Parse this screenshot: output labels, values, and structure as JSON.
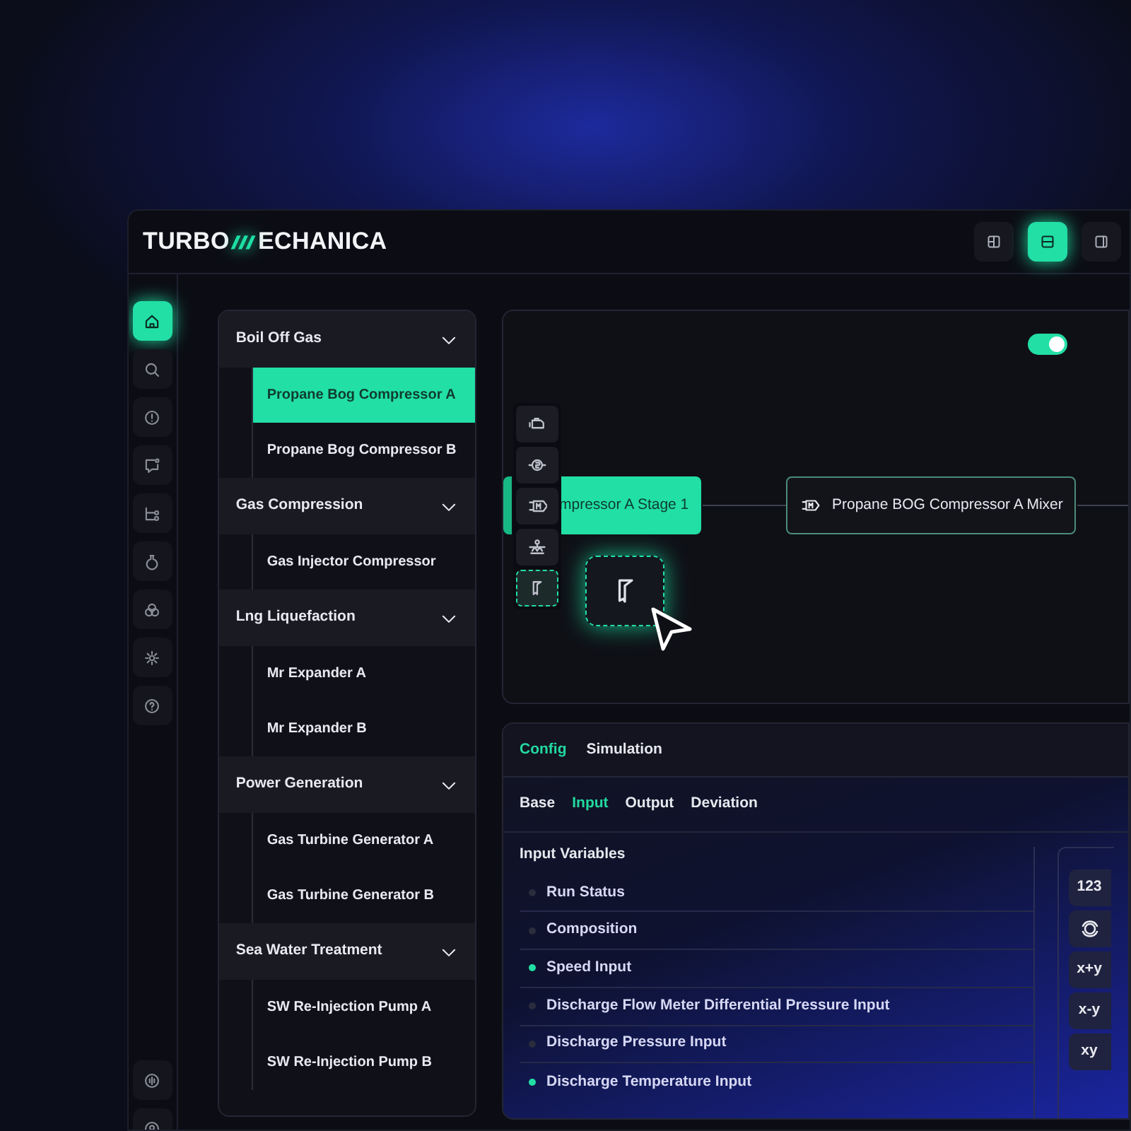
{
  "header": {
    "logo_left": "TURBO",
    "logo_right": "ECHANICA",
    "layout_buttons": [
      {
        "selected": false
      },
      {
        "selected": true
      },
      {
        "selected": false
      }
    ]
  },
  "rail": {
    "items": [
      {
        "selected": true
      },
      {
        "selected": false
      },
      {
        "selected": false
      },
      {
        "selected": false
      },
      {
        "selected": false
      },
      {
        "selected": false
      },
      {
        "selected": false
      },
      {
        "selected": false
      },
      {
        "selected": false
      }
    ],
    "bottom_items": [
      {
        "selected": false
      },
      {
        "selected": false
      }
    ]
  },
  "tree": [
    {
      "label": "Boil Off Gas",
      "expanded": true,
      "children": [
        {
          "label": "Propane Bog Compressor A",
          "selected": true
        },
        {
          "label": "Propane Bog Compressor B",
          "selected": false
        }
      ]
    },
    {
      "label": "Gas Compression",
      "expanded": true,
      "children": [
        {
          "label": "Gas Injector Compressor",
          "selected": false
        }
      ]
    },
    {
      "label": "Lng Liquefaction",
      "expanded": true,
      "children": [
        {
          "label": "Mr Expander A",
          "selected": false
        },
        {
          "label": "Mr Expander B",
          "selected": false
        }
      ]
    },
    {
      "label": "Power Generation",
      "expanded": true,
      "children": [
        {
          "label": "Gas Turbine Generator A",
          "selected": false
        },
        {
          "label": "Gas Turbine Generator B",
          "selected": false
        }
      ]
    },
    {
      "label": "Sea Water Treatment",
      "expanded": true,
      "children": [
        {
          "label": "SW Re-Injection Pump A",
          "selected": false
        },
        {
          "label": "SW Re-Injection Pump B",
          "selected": false
        }
      ]
    }
  ],
  "canvas": {
    "toggle": {
      "on": true
    },
    "tools": [
      {
        "selected": false
      },
      {
        "selected": false
      },
      {
        "selected": false
      },
      {
        "selected": false
      },
      {
        "selected": true
      }
    ],
    "nodes": [
      {
        "label": "mpressor A Stage 1",
        "selected": true
      },
      {
        "label": "Propane BOG Compressor A Mixer",
        "selected": false
      }
    ]
  },
  "config": {
    "tabs": [
      {
        "label": "Config",
        "selected": true
      },
      {
        "label": "Simulation",
        "selected": false
      }
    ],
    "subtabs": [
      {
        "label": "Base",
        "selected": false
      },
      {
        "label": "Input",
        "selected": true
      },
      {
        "label": "Output",
        "selected": false
      },
      {
        "label": "Deviation",
        "selected": false
      }
    ],
    "section_title": "Input Variables",
    "variables": [
      {
        "label": "Run Status",
        "active": false
      },
      {
        "label": "Composition",
        "active": false
      },
      {
        "label": "Speed Input",
        "active": true
      },
      {
        "label": "Discharge Flow Meter Differential Pressure Input",
        "active": false
      },
      {
        "label": "Discharge Pressure Input",
        "active": false
      },
      {
        "label": "Discharge Temperature Input",
        "active": true
      }
    ],
    "calc_buttons": [
      {
        "kind": "text",
        "label": "123"
      },
      {
        "kind": "icon"
      },
      {
        "kind": "text",
        "label": "x+y"
      },
      {
        "kind": "text",
        "label": "x-y"
      },
      {
        "kind": "text",
        "label": "xy"
      }
    ]
  }
}
